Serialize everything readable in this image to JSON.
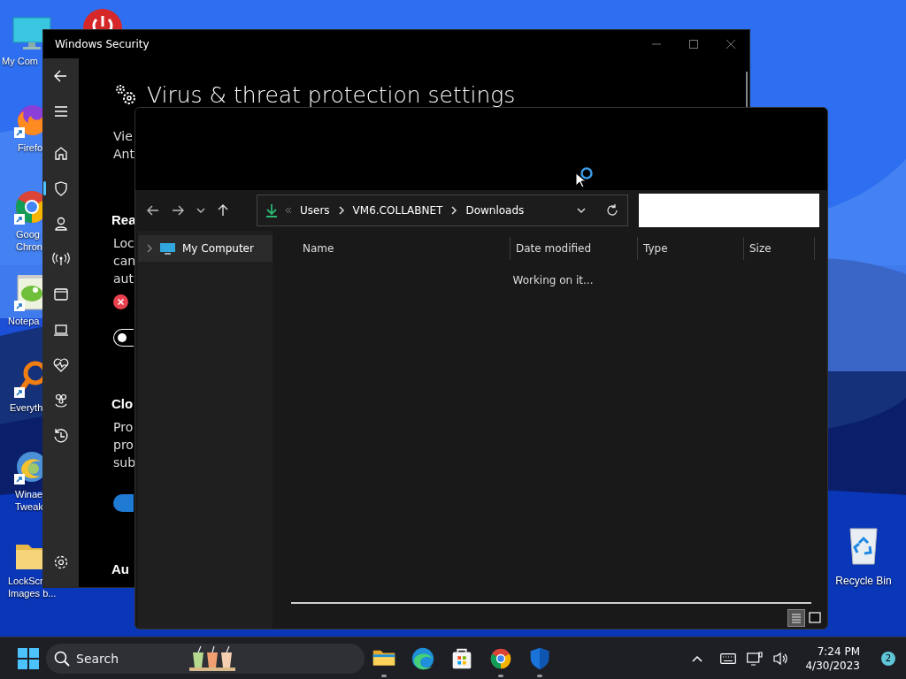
{
  "desktop": {
    "icons": [
      {
        "kind": "monitor",
        "shortcut": false,
        "label": [
          "My Com"
        ]
      },
      {
        "kind": "firefox",
        "shortcut": true,
        "label": [
          "Firefo"
        ]
      },
      {
        "kind": "chrome",
        "shortcut": true,
        "label": [
          "Goog",
          "Chron"
        ]
      },
      {
        "kind": "notepad",
        "shortcut": true,
        "label": [
          "Notepa"
        ]
      },
      {
        "kind": "magnifier",
        "shortcut": true,
        "label": [
          "Everyth"
        ]
      },
      {
        "kind": "winaero",
        "shortcut": true,
        "label": [
          "Winae",
          "Tweak"
        ]
      },
      {
        "kind": "folder",
        "shortcut": false,
        "label": [
          "LockScr",
          "Images b..."
        ]
      }
    ],
    "recycle_bin": {
      "label": "Recycle Bin"
    }
  },
  "security_window": {
    "title": "Windows Security",
    "heading": "Virus & threat protection settings",
    "nav_items": [
      {
        "kind": "back",
        "selected": false
      },
      {
        "kind": "menu",
        "selected": false
      },
      {
        "kind": "home",
        "selected": false
      },
      {
        "kind": "shield",
        "selected": true
      },
      {
        "kind": "person",
        "selected": false
      },
      {
        "kind": "antenna",
        "selected": false
      },
      {
        "kind": "window",
        "selected": false
      },
      {
        "kind": "laptop",
        "selected": false
      },
      {
        "kind": "heart",
        "selected": false
      },
      {
        "kind": "family",
        "selected": false
      },
      {
        "kind": "history",
        "selected": false
      },
      {
        "kind": "settings",
        "selected": false
      }
    ],
    "content": [
      {
        "kind": "paragraph",
        "lines": [
          "Vie",
          "Ant"
        ]
      },
      {
        "kind": "heading",
        "text": "Rea"
      },
      {
        "kind": "paragraph",
        "lines": [
          "Loc",
          "can",
          "aut"
        ]
      },
      {
        "kind": "error"
      },
      {
        "kind": "toggle",
        "on": false
      },
      {
        "kind": "heading",
        "text": "Clo"
      },
      {
        "kind": "paragraph",
        "lines": [
          "Pro",
          "pro",
          "sub"
        ]
      },
      {
        "kind": "toggle",
        "on": true
      },
      {
        "kind": "heading",
        "text": "Au"
      }
    ]
  },
  "file_dialog": {
    "address": {
      "segments": [
        "Users",
        "VM6.COLLABNET",
        "Downloads"
      ]
    },
    "nav_pane": {
      "items": [
        {
          "label": "My Computer",
          "expanded": false
        }
      ]
    },
    "columns": [
      "Name",
      "Date modified",
      "Type",
      "Size"
    ],
    "status": "Working on it...",
    "view_buttons": [
      {
        "kind": "details",
        "selected": true
      },
      {
        "kind": "large-icons",
        "selected": false
      }
    ]
  },
  "taskbar": {
    "search": {
      "placeholder": "Search"
    },
    "apps": [
      {
        "kind": "file-explorer",
        "running": true
      },
      {
        "kind": "edge",
        "running": false
      },
      {
        "kind": "store",
        "running": false
      },
      {
        "kind": "chrome",
        "running": true
      },
      {
        "kind": "defender",
        "running": true
      }
    ],
    "time": "7:24 PM",
    "date": "4/30/2023",
    "notification_count": "2"
  }
}
